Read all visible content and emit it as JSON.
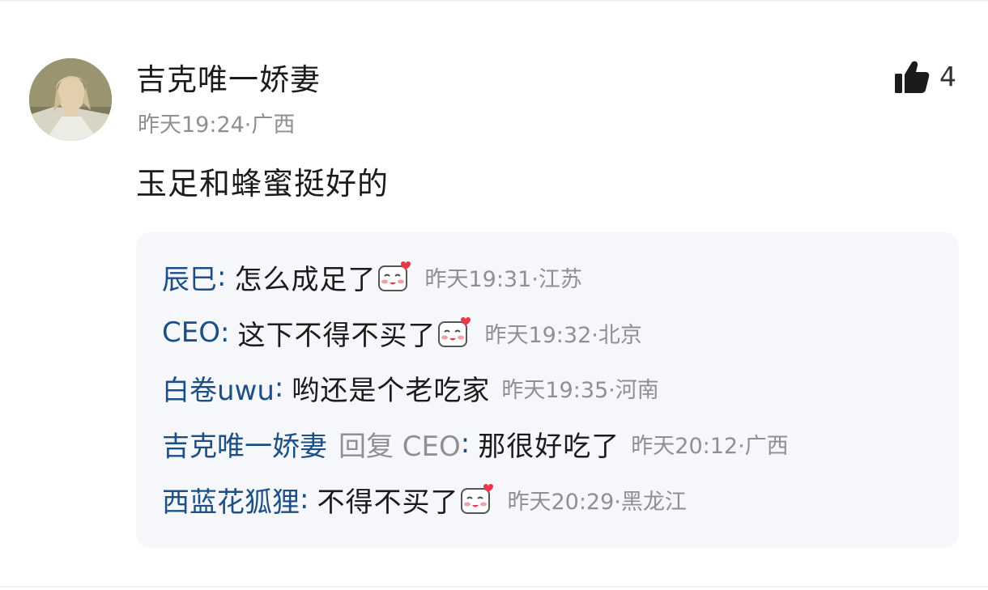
{
  "comment": {
    "username": "吉克唯一娇妻",
    "meta": "昨天19:24·广西",
    "text": "玉足和蜂蜜挺好的",
    "like_count": "4"
  },
  "replies": [
    {
      "name": "辰巳",
      "colon": ":",
      "text": "怎么成足了",
      "emoji": "blush-emoji",
      "time": "昨天19:31·江苏"
    },
    {
      "name": "CEO",
      "colon": ":",
      "text": "这下不得不买了",
      "emoji": "blush-emoji",
      "time": "昨天19:32·北京"
    },
    {
      "name": "白卷uwu",
      "colon": ":",
      "text": "哟还是个老吃家",
      "time": "昨天19:35·河南"
    },
    {
      "name": "吉克唯一娇妻",
      "reply_to": "回复 CEO",
      "colon": ":",
      "text": "那很好吃了",
      "time": "昨天20:12·广西"
    },
    {
      "name": "西蓝花狐狸",
      "colon": ":",
      "text": "不得不买了",
      "emoji": "blush-emoji",
      "time": "昨天20:29·黑龙江"
    }
  ],
  "colors": {
    "name_link": "#1d4f87",
    "muted": "#8f8f95",
    "reply_bg": "#f6f7fa",
    "emoji_heart": "#e8394b"
  }
}
